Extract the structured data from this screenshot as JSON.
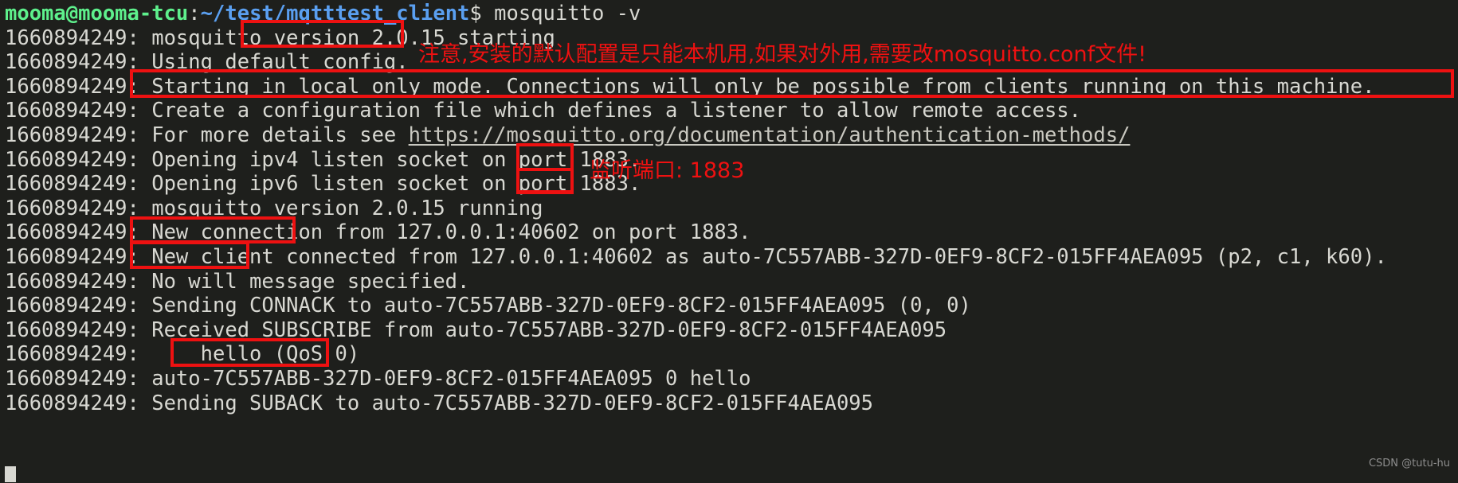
{
  "terminal": {
    "background_color": "#1e1f1c",
    "foreground_color": "#d8d8d2",
    "prompt": {
      "user_host": "mooma@mooma-tcu",
      "separator": ":",
      "path": "~/test/mqtttest_client",
      "sigil": "$",
      "command": " mosquitto -v"
    },
    "lines": [
      "1660894249: mosquitto version 2.0.15 starting",
      "1660894249: Using default config.",
      "1660894249: Starting in local only mode. Connections will only be possible from clients running on this machine.",
      "1660894249: Create a configuration file which defines a listener to allow remote access.",
      "1660894249: For more details see ",
      "1660894249: Opening ipv4 listen socket on port 1883.",
      "1660894249: Opening ipv6 listen socket on port 1883.",
      "1660894249: mosquitto version 2.0.15 running",
      "1660894249: New connection from 127.0.0.1:40602 on port 1883.",
      "1660894249: New client connected from 127.0.0.1:40602 as auto-7C557ABB-327D-0EF9-8CF2-015FF4AEA095 (p2, c1, k60).",
      "1660894249: No will message specified.",
      "1660894249: Sending CONNACK to auto-7C557ABB-327D-0EF9-8CF2-015FF4AEA095 (0, 0)",
      "1660894249: Received SUBSCRIBE from auto-7C557ABB-327D-0EF9-8CF2-015FF4AEA095",
      "1660894249:     hello (QoS 0)",
      "1660894249: auto-7C557ABB-327D-0EF9-8CF2-015FF4AEA095 0 hello",
      "1660894249: Sending SUBACK to auto-7C557ABB-327D-0EF9-8CF2-015FF4AEA095"
    ],
    "link_url": "https://mosquitto.org/documentation/authentication-methods/"
  },
  "annotations": {
    "color": "#ee1111",
    "notes": [
      {
        "text": "注意,安装的默认配置是只能本机用,如果对外用,需要改mosquitto.conf文件!"
      },
      {
        "text": "监听端口: 1883"
      }
    ],
    "highlight_boxes": [
      {
        "label": "version 2.0.15"
      },
      {
        "label": "Starting in local only mode. Connections will only be possible from clients running on this machine."
      },
      {
        "label": "1883."
      },
      {
        "label": "1883."
      },
      {
        "label": "New connection"
      },
      {
        "label": "New client"
      },
      {
        "label": "hello (QoS 0)"
      }
    ]
  },
  "watermark": {
    "text": "CSDN @tutu-hu"
  }
}
